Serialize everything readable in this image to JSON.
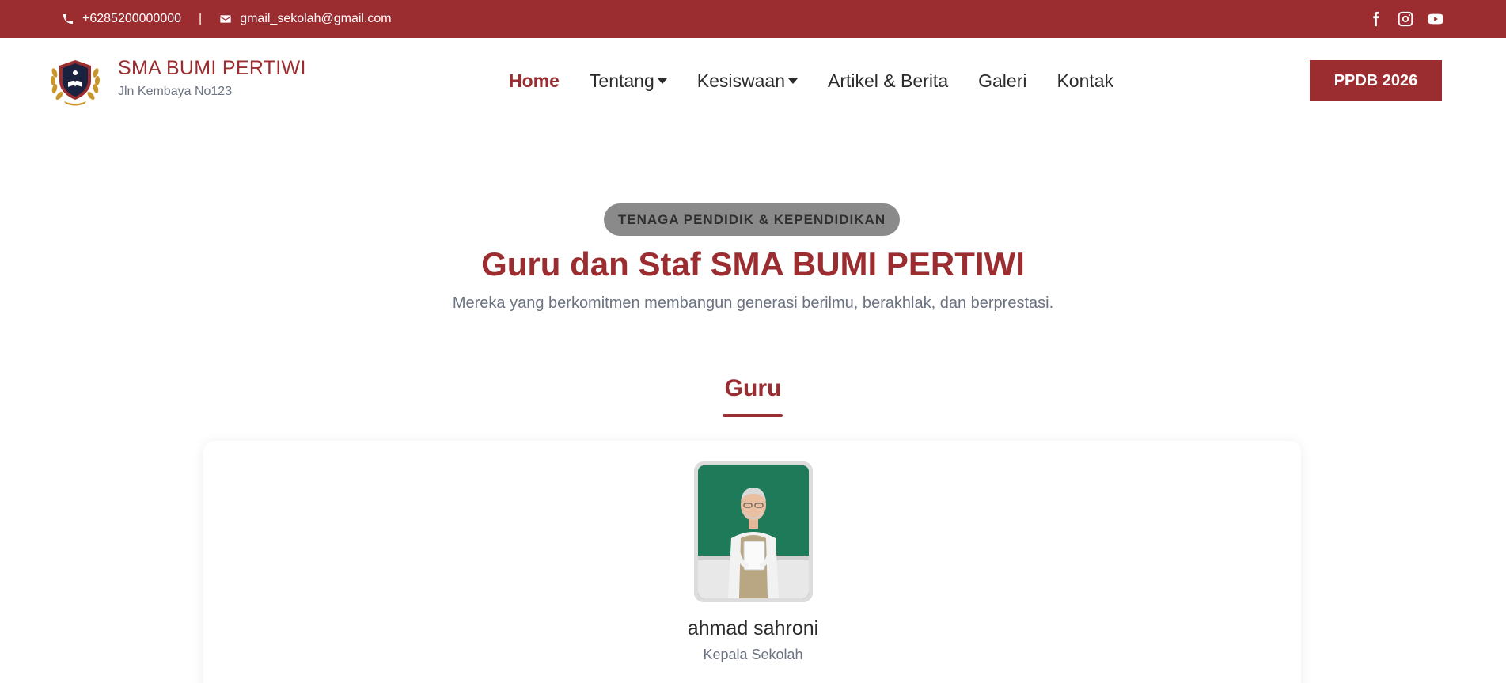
{
  "topbar": {
    "phone": "+6285200000000",
    "separator": "|",
    "email": "gmail_sekolah@gmail.com",
    "phone_icon": "phone-icon",
    "email_icon": "envelope-icon",
    "socials": [
      "facebook-icon",
      "instagram-icon",
      "youtube-icon"
    ]
  },
  "header": {
    "school_name": "SMA BUMI PERTIWI",
    "address": "Jln Kembaya No123",
    "logo_icon": "school-crest-logo",
    "nav": {
      "home": "Home",
      "tentang": "Tentang",
      "kesiswaan": "Kesiswaan",
      "artikel": "Artikel & Berita",
      "galeri": "Galeri",
      "kontak": "Kontak"
    },
    "cta": "PPDB 2026"
  },
  "section": {
    "pill": "TENAGA PENDIDIK & KEPENDIDIKAN",
    "title": "Guru dan Staf SMA BUMI PERTIWI",
    "subtitle": "Mereka yang berkomitmen membangun generasi berilmu, berakhlak, dan berprestasi.",
    "group_title": "Guru"
  },
  "staff": [
    {
      "name": "ahmad sahroni",
      "role": "Kepala Sekolah"
    }
  ],
  "colors": {
    "primary": "#9b2c30",
    "muted_text": "#6b7280",
    "pill_bg": "#8a8a8a",
    "dark_text": "#2b2b2b"
  }
}
